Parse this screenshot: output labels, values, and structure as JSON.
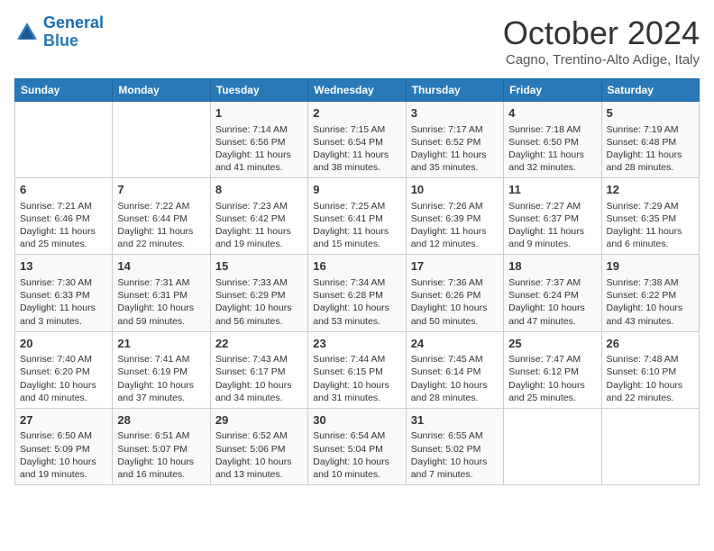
{
  "header": {
    "logo_line1": "General",
    "logo_line2": "Blue",
    "title": "October 2024",
    "subtitle": "Cagno, Trentino-Alto Adige, Italy"
  },
  "days_of_week": [
    "Sunday",
    "Monday",
    "Tuesday",
    "Wednesday",
    "Thursday",
    "Friday",
    "Saturday"
  ],
  "weeks": [
    [
      {
        "day": "",
        "content": ""
      },
      {
        "day": "",
        "content": ""
      },
      {
        "day": "1",
        "content": "Sunrise: 7:14 AM\nSunset: 6:56 PM\nDaylight: 11 hours and 41 minutes."
      },
      {
        "day": "2",
        "content": "Sunrise: 7:15 AM\nSunset: 6:54 PM\nDaylight: 11 hours and 38 minutes."
      },
      {
        "day": "3",
        "content": "Sunrise: 7:17 AM\nSunset: 6:52 PM\nDaylight: 11 hours and 35 minutes."
      },
      {
        "day": "4",
        "content": "Sunrise: 7:18 AM\nSunset: 6:50 PM\nDaylight: 11 hours and 32 minutes."
      },
      {
        "day": "5",
        "content": "Sunrise: 7:19 AM\nSunset: 6:48 PM\nDaylight: 11 hours and 28 minutes."
      }
    ],
    [
      {
        "day": "6",
        "content": "Sunrise: 7:21 AM\nSunset: 6:46 PM\nDaylight: 11 hours and 25 minutes."
      },
      {
        "day": "7",
        "content": "Sunrise: 7:22 AM\nSunset: 6:44 PM\nDaylight: 11 hours and 22 minutes."
      },
      {
        "day": "8",
        "content": "Sunrise: 7:23 AM\nSunset: 6:42 PM\nDaylight: 11 hours and 19 minutes."
      },
      {
        "day": "9",
        "content": "Sunrise: 7:25 AM\nSunset: 6:41 PM\nDaylight: 11 hours and 15 minutes."
      },
      {
        "day": "10",
        "content": "Sunrise: 7:26 AM\nSunset: 6:39 PM\nDaylight: 11 hours and 12 minutes."
      },
      {
        "day": "11",
        "content": "Sunrise: 7:27 AM\nSunset: 6:37 PM\nDaylight: 11 hours and 9 minutes."
      },
      {
        "day": "12",
        "content": "Sunrise: 7:29 AM\nSunset: 6:35 PM\nDaylight: 11 hours and 6 minutes."
      }
    ],
    [
      {
        "day": "13",
        "content": "Sunrise: 7:30 AM\nSunset: 6:33 PM\nDaylight: 11 hours and 3 minutes."
      },
      {
        "day": "14",
        "content": "Sunrise: 7:31 AM\nSunset: 6:31 PM\nDaylight: 10 hours and 59 minutes."
      },
      {
        "day": "15",
        "content": "Sunrise: 7:33 AM\nSunset: 6:29 PM\nDaylight: 10 hours and 56 minutes."
      },
      {
        "day": "16",
        "content": "Sunrise: 7:34 AM\nSunset: 6:28 PM\nDaylight: 10 hours and 53 minutes."
      },
      {
        "day": "17",
        "content": "Sunrise: 7:36 AM\nSunset: 6:26 PM\nDaylight: 10 hours and 50 minutes."
      },
      {
        "day": "18",
        "content": "Sunrise: 7:37 AM\nSunset: 6:24 PM\nDaylight: 10 hours and 47 minutes."
      },
      {
        "day": "19",
        "content": "Sunrise: 7:38 AM\nSunset: 6:22 PM\nDaylight: 10 hours and 43 minutes."
      }
    ],
    [
      {
        "day": "20",
        "content": "Sunrise: 7:40 AM\nSunset: 6:20 PM\nDaylight: 10 hours and 40 minutes."
      },
      {
        "day": "21",
        "content": "Sunrise: 7:41 AM\nSunset: 6:19 PM\nDaylight: 10 hours and 37 minutes."
      },
      {
        "day": "22",
        "content": "Sunrise: 7:43 AM\nSunset: 6:17 PM\nDaylight: 10 hours and 34 minutes."
      },
      {
        "day": "23",
        "content": "Sunrise: 7:44 AM\nSunset: 6:15 PM\nDaylight: 10 hours and 31 minutes."
      },
      {
        "day": "24",
        "content": "Sunrise: 7:45 AM\nSunset: 6:14 PM\nDaylight: 10 hours and 28 minutes."
      },
      {
        "day": "25",
        "content": "Sunrise: 7:47 AM\nSunset: 6:12 PM\nDaylight: 10 hours and 25 minutes."
      },
      {
        "day": "26",
        "content": "Sunrise: 7:48 AM\nSunset: 6:10 PM\nDaylight: 10 hours and 22 minutes."
      }
    ],
    [
      {
        "day": "27",
        "content": "Sunrise: 6:50 AM\nSunset: 5:09 PM\nDaylight: 10 hours and 19 minutes."
      },
      {
        "day": "28",
        "content": "Sunrise: 6:51 AM\nSunset: 5:07 PM\nDaylight: 10 hours and 16 minutes."
      },
      {
        "day": "29",
        "content": "Sunrise: 6:52 AM\nSunset: 5:06 PM\nDaylight: 10 hours and 13 minutes."
      },
      {
        "day": "30",
        "content": "Sunrise: 6:54 AM\nSunset: 5:04 PM\nDaylight: 10 hours and 10 minutes."
      },
      {
        "day": "31",
        "content": "Sunrise: 6:55 AM\nSunset: 5:02 PM\nDaylight: 10 hours and 7 minutes."
      },
      {
        "day": "",
        "content": ""
      },
      {
        "day": "",
        "content": ""
      }
    ]
  ]
}
